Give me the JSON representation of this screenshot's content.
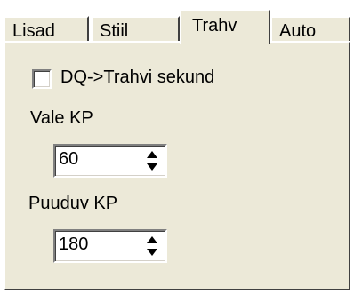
{
  "tabs": [
    {
      "label": "Lisad",
      "active": false
    },
    {
      "label": "Stiil",
      "active": false
    },
    {
      "label": "Trahv",
      "active": true
    },
    {
      "label": "Auto",
      "active": false
    }
  ],
  "panel": {
    "checkbox": {
      "label": "DQ->Trahvi sekund",
      "checked": false
    },
    "vale_kp": {
      "label": "Vale KP",
      "value": "60"
    },
    "puuduv_kp": {
      "label": "Puuduv KP",
      "value": "180"
    }
  }
}
